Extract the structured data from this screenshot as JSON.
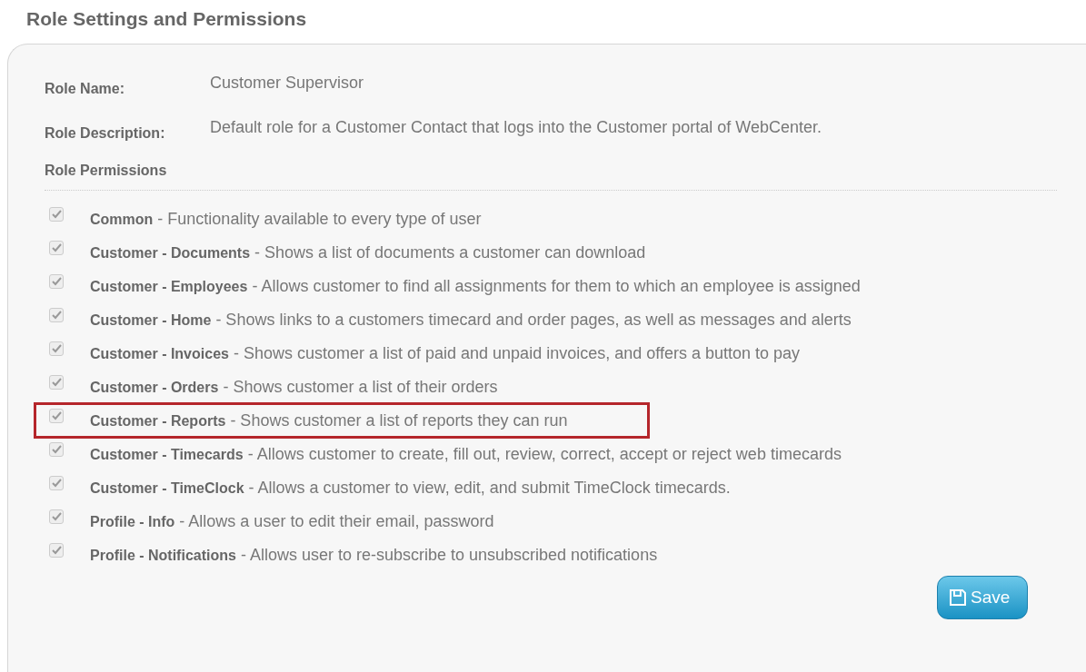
{
  "page_title": "Role Settings and Permissions",
  "fields": [
    {
      "label": "Role Name:",
      "value": "Customer Supervisor"
    },
    {
      "label": "Role Description:",
      "value": "Default role for a Customer Contact that logs into the Customer portal of WebCenter."
    }
  ],
  "permissions_heading": "Role Permissions",
  "permissions": [
    {
      "name": "Common",
      "description": "- Functionality available to every type of user",
      "checked": true,
      "disabled": true,
      "highlighted": false
    },
    {
      "name": "Customer - Documents",
      "description": "- Shows a list of documents a customer can download",
      "checked": true,
      "disabled": true,
      "highlighted": false
    },
    {
      "name": "Customer - Employees",
      "description": "- Allows customer to find all assignments for them to which an employee is assigned",
      "checked": true,
      "disabled": true,
      "highlighted": false
    },
    {
      "name": "Customer - Home",
      "description": "- Shows links to a customers timecard and order pages, as well as messages and alerts",
      "checked": true,
      "disabled": true,
      "highlighted": false
    },
    {
      "name": "Customer - Invoices",
      "description": "- Shows customer a list of paid and unpaid invoices, and offers a button to pay",
      "checked": true,
      "disabled": true,
      "highlighted": false
    },
    {
      "name": "Customer - Orders",
      "description": "- Shows customer a list of their orders",
      "checked": true,
      "disabled": true,
      "highlighted": false
    },
    {
      "name": "Customer - Reports",
      "description": "- Shows customer a list of reports they can run",
      "checked": true,
      "disabled": true,
      "highlighted": true
    },
    {
      "name": "Customer - Timecards",
      "description": "- Allows customer to create, fill out, review, correct, accept or reject web timecards",
      "checked": true,
      "disabled": true,
      "highlighted": false
    },
    {
      "name": "Customer - TimeClock",
      "description": "- Allows a customer to view, edit, and submit TimeClock timecards.",
      "checked": true,
      "disabled": true,
      "highlighted": false
    },
    {
      "name": "Profile - Info",
      "description": "- Allows a user to edit their email, password",
      "checked": true,
      "disabled": true,
      "highlighted": false
    },
    {
      "name": "Profile - Notifications",
      "description": "- Allows user to re-subscribe to unsubscribed notifications",
      "checked": true,
      "disabled": true,
      "highlighted": false
    }
  ],
  "save_button": "Save"
}
